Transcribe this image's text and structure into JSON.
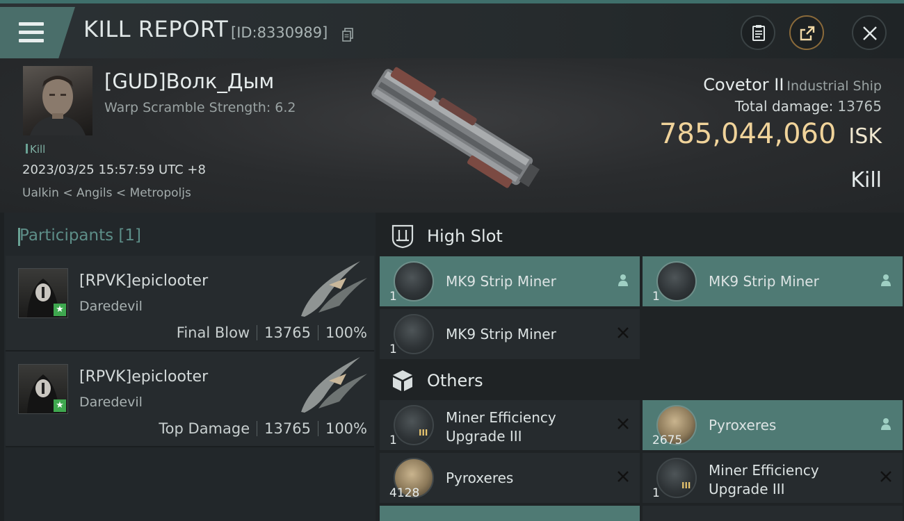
{
  "header": {
    "title": "KILL REPORT",
    "id_label": "[ID:8330989]"
  },
  "victim": {
    "name": "[GUD]Волк_Дым",
    "warp_scramble": "Warp Scramble Strength: 6.2",
    "tag": "Kill",
    "datetime": "2023/03/25 15:57:59 UTC +8",
    "location": "Ualkin < Angils < Metropoljs",
    "ship_name": "Covetor II",
    "ship_class": "Industrial Ship",
    "total_damage_label": "Total damage:",
    "total_damage": "13765",
    "isk_value": "785,044,060",
    "isk_currency": "ISK",
    "result": "Kill"
  },
  "participants": {
    "title": "Participants [1]",
    "rows": [
      {
        "name": "[RPVK]epiclooter",
        "ship": "Daredevil",
        "role": "Final Blow",
        "damage": "13765",
        "percent": "100%"
      },
      {
        "name": "[RPVK]epiclooter",
        "ship": "Daredevil",
        "role": "Top Damage",
        "damage": "13765",
        "percent": "100%"
      }
    ]
  },
  "high_slot": {
    "title": "High Slot",
    "items": [
      {
        "name": "MK9 Strip Miner",
        "qty": "1",
        "status": "dropped"
      },
      {
        "name": "MK9 Strip Miner",
        "qty": "1",
        "status": "dropped"
      },
      {
        "name": "MK9 Strip Miner",
        "qty": "1",
        "status": "destroyed"
      }
    ]
  },
  "others": {
    "title": "Others",
    "items": [
      {
        "name": "Miner Efficiency Upgrade III",
        "line1": "Miner Efficiency",
        "line2": "Upgrade III",
        "qty": "1",
        "status": "destroyed"
      },
      {
        "name": "Pyroxeres",
        "qty": "2675",
        "status": "dropped"
      },
      {
        "name": "Pyroxeres",
        "qty": "4128",
        "status": "destroyed"
      },
      {
        "name": "Miner Efficiency Upgrade III",
        "line1": "Miner Efficiency",
        "line2": "Upgrade III",
        "qty": "1",
        "status": "destroyed"
      }
    ]
  },
  "colors": {
    "accent": "#4f7a74",
    "isk": "#f0d39a",
    "panel": "#262b2e"
  }
}
